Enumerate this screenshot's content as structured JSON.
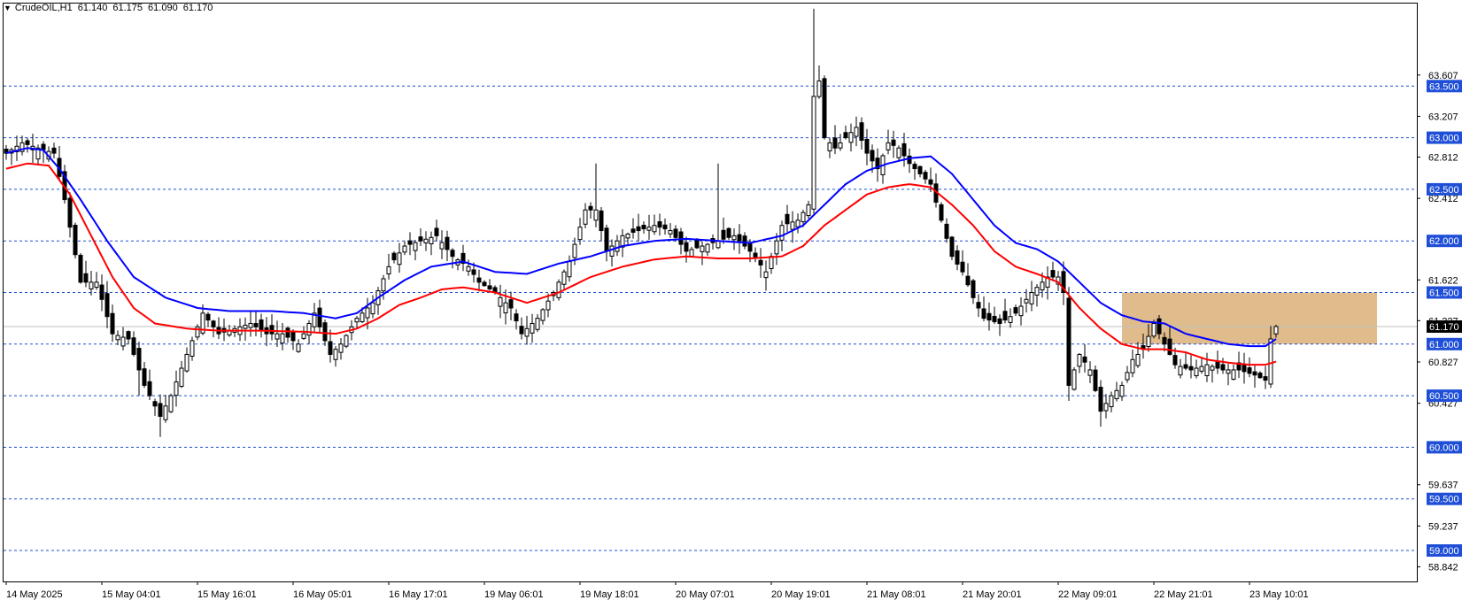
{
  "header": {
    "symbol": "CrudeOIL,H1",
    "open": "61.140",
    "high": "61.175",
    "low": "61.090",
    "close": "61.170",
    "menu_icon": "triangle-down-icon"
  },
  "chart_data": {
    "type": "candlestick",
    "title": "",
    "ylim": [
      58.7,
      64.3
    ],
    "grid": false,
    "colors": {
      "background": "#ffffff",
      "bull_body": "#ffffff",
      "bear_body": "#000000",
      "wick": "#000000",
      "ma_fast": "#0000ff",
      "ma_slow": "#ff0000",
      "level_lines": "#1f4fd6",
      "zone_fill": "#deb887",
      "current_price_line": "#c0c0c0"
    },
    "y_ticks": [
      "63.607",
      "63.207",
      "62.812",
      "62.412",
      "61.622",
      "61.227",
      "60.827",
      "60.427",
      "59.637",
      "59.237",
      "58.842"
    ],
    "y_tick_values": [
      63.607,
      63.207,
      62.812,
      62.412,
      61.622,
      61.227,
      60.827,
      60.427,
      59.637,
      59.237,
      58.842
    ],
    "levels": [
      "63.500",
      "63.000",
      "62.500",
      "62.000",
      "61.500",
      "61.000",
      "60.500",
      "60.000",
      "59.500",
      "59.000"
    ],
    "level_values": [
      63.5,
      63.0,
      62.5,
      62.0,
      61.5,
      61.0,
      60.5,
      60.0,
      59.5,
      59.0
    ],
    "current_price": "61.170",
    "current_price_value": 61.17,
    "zone": {
      "start_bar": 210,
      "end_bar": 258,
      "low": 61.0,
      "high": 61.5
    },
    "x_labels": [
      "14 May 2025",
      "15 May 04:01",
      "15 May 16:01",
      "16 May 05:01",
      "16 May 17:01",
      "19 May 06:01",
      "19 May 18:01",
      "20 May 07:01",
      "20 May 19:01",
      "21 May 08:01",
      "21 May 20:01",
      "22 May 09:01",
      "22 May 21:01",
      "23 May 10:01"
    ],
    "x_label_bars": [
      0,
      18,
      36,
      54,
      72,
      90,
      108,
      126,
      144,
      162,
      180,
      198,
      216,
      234
    ],
    "total_bars": 300,
    "close_anchors": [
      [
        0,
        62.85
      ],
      [
        3,
        62.95
      ],
      [
        6,
        62.9
      ],
      [
        9,
        62.85
      ],
      [
        11,
        62.4
      ],
      [
        14,
        61.6
      ],
      [
        17,
        61.6
      ],
      [
        20,
        61.1
      ],
      [
        23,
        61.05
      ],
      [
        26,
        60.6
      ],
      [
        29,
        60.3
      ],
      [
        31,
        60.5
      ],
      [
        34,
        60.9
      ],
      [
        37,
        61.3
      ],
      [
        40,
        61.1
      ],
      [
        43,
        61.15
      ],
      [
        46,
        61.2
      ],
      [
        49,
        61.1
      ],
      [
        52,
        61.1
      ],
      [
        55,
        61.0
      ],
      [
        58,
        61.3
      ],
      [
        61,
        60.9
      ],
      [
        63,
        61.0
      ],
      [
        66,
        61.25
      ],
      [
        69,
        61.4
      ],
      [
        72,
        61.75
      ],
      [
        75,
        61.95
      ],
      [
        78,
        62.0
      ],
      [
        81,
        62.05
      ],
      [
        84,
        61.85
      ],
      [
        87,
        61.75
      ],
      [
        89,
        61.6
      ],
      [
        92,
        61.5
      ],
      [
        95,
        61.35
      ],
      [
        97,
        61.1
      ],
      [
        100,
        61.25
      ],
      [
        103,
        61.5
      ],
      [
        106,
        61.8
      ],
      [
        109,
        62.3
      ],
      [
        111,
        62.3
      ],
      [
        113,
        61.9
      ],
      [
        116,
        62.05
      ],
      [
        119,
        62.1
      ],
      [
        122,
        62.15
      ],
      [
        125,
        62.1
      ],
      [
        128,
        61.9
      ],
      [
        131,
        61.95
      ],
      [
        134,
        62.0
      ],
      [
        137,
        62.05
      ],
      [
        140,
        61.9
      ],
      [
        143,
        61.7
      ],
      [
        146,
        62.15
      ],
      [
        149,
        62.2
      ],
      [
        151,
        62.35
      ],
      [
        152,
        63.4
      ],
      [
        153,
        63.55
      ],
      [
        154,
        63.0
      ],
      [
        156,
        62.9
      ],
      [
        158,
        63.0
      ],
      [
        160,
        63.1
      ],
      [
        162,
        62.85
      ],
      [
        164,
        62.7
      ],
      [
        166,
        62.95
      ],
      [
        168,
        62.9
      ],
      [
        170,
        62.75
      ],
      [
        172,
        62.65
      ],
      [
        174,
        62.55
      ],
      [
        176,
        62.2
      ],
      [
        178,
        61.85
      ],
      [
        180,
        61.7
      ],
      [
        182,
        61.45
      ],
      [
        184,
        61.25
      ],
      [
        187,
        61.2
      ],
      [
        190,
        61.3
      ],
      [
        193,
        61.5
      ],
      [
        196,
        61.65
      ],
      [
        198,
        61.65
      ],
      [
        199,
        61.5
      ],
      [
        200,
        60.6
      ],
      [
        202,
        60.9
      ],
      [
        204,
        60.75
      ],
      [
        206,
        60.35
      ],
      [
        208,
        60.5
      ],
      [
        210,
        60.6
      ],
      [
        212,
        60.85
      ],
      [
        214,
        60.95
      ],
      [
        216,
        61.2
      ],
      [
        218,
        61.0
      ],
      [
        220,
        60.8
      ],
      [
        223,
        60.75
      ],
      [
        226,
        60.8
      ],
      [
        229,
        60.75
      ],
      [
        232,
        60.75
      ],
      [
        235,
        60.7
      ],
      [
        237,
        60.65
      ],
      [
        238,
        61.05
      ],
      [
        239,
        61.17
      ]
    ],
    "ma_fast_anchors": [
      [
        0,
        62.85
      ],
      [
        4,
        62.9
      ],
      [
        7,
        62.88
      ],
      [
        10,
        62.7
      ],
      [
        14,
        62.4
      ],
      [
        19,
        62.0
      ],
      [
        24,
        61.65
      ],
      [
        30,
        61.45
      ],
      [
        36,
        61.35
      ],
      [
        42,
        61.32
      ],
      [
        50,
        61.32
      ],
      [
        56,
        61.3
      ],
      [
        62,
        61.25
      ],
      [
        66,
        61.3
      ],
      [
        70,
        61.45
      ],
      [
        75,
        61.62
      ],
      [
        80,
        61.75
      ],
      [
        86,
        61.8
      ],
      [
        92,
        61.7
      ],
      [
        98,
        61.68
      ],
      [
        104,
        61.78
      ],
      [
        110,
        61.85
      ],
      [
        116,
        61.95
      ],
      [
        122,
        62.0
      ],
      [
        128,
        62.02
      ],
      [
        134,
        62.0
      ],
      [
        140,
        61.98
      ],
      [
        146,
        62.05
      ],
      [
        150,
        62.15
      ],
      [
        154,
        62.35
      ],
      [
        158,
        62.55
      ],
      [
        162,
        62.68
      ],
      [
        166,
        62.75
      ],
      [
        170,
        62.8
      ],
      [
        174,
        62.82
      ],
      [
        178,
        62.65
      ],
      [
        182,
        62.4
      ],
      [
        186,
        62.15
      ],
      [
        190,
        61.98
      ],
      [
        194,
        61.92
      ],
      [
        198,
        61.8
      ],
      [
        202,
        61.6
      ],
      [
        206,
        61.4
      ],
      [
        210,
        61.28
      ],
      [
        214,
        61.22
      ],
      [
        218,
        61.2
      ],
      [
        222,
        61.1
      ],
      [
        226,
        61.05
      ],
      [
        230,
        61.0
      ],
      [
        234,
        60.98
      ],
      [
        237,
        60.98
      ],
      [
        239,
        61.05
      ]
    ],
    "ma_slow_anchors": [
      [
        0,
        62.7
      ],
      [
        4,
        62.75
      ],
      [
        8,
        62.73
      ],
      [
        12,
        62.45
      ],
      [
        16,
        62.05
      ],
      [
        20,
        61.65
      ],
      [
        24,
        61.35
      ],
      [
        28,
        61.2
      ],
      [
        34,
        61.15
      ],
      [
        40,
        61.13
      ],
      [
        48,
        61.13
      ],
      [
        56,
        61.12
      ],
      [
        62,
        61.1
      ],
      [
        66,
        61.15
      ],
      [
        70,
        61.25
      ],
      [
        74,
        61.38
      ],
      [
        78,
        61.45
      ],
      [
        82,
        61.53
      ],
      [
        86,
        61.55
      ],
      [
        92,
        61.5
      ],
      [
        98,
        61.4
      ],
      [
        104,
        61.5
      ],
      [
        110,
        61.65
      ],
      [
        116,
        61.75
      ],
      [
        122,
        61.82
      ],
      [
        128,
        61.85
      ],
      [
        134,
        61.83
      ],
      [
        140,
        61.83
      ],
      [
        146,
        61.85
      ],
      [
        150,
        61.95
      ],
      [
        154,
        62.15
      ],
      [
        158,
        62.3
      ],
      [
        162,
        62.45
      ],
      [
        166,
        62.52
      ],
      [
        170,
        62.55
      ],
      [
        174,
        62.52
      ],
      [
        178,
        62.35
      ],
      [
        182,
        62.15
      ],
      [
        186,
        61.9
      ],
      [
        190,
        61.75
      ],
      [
        194,
        61.68
      ],
      [
        198,
        61.6
      ],
      [
        202,
        61.35
      ],
      [
        206,
        61.15
      ],
      [
        210,
        61.0
      ],
      [
        214,
        60.95
      ],
      [
        218,
        60.95
      ],
      [
        222,
        60.92
      ],
      [
        226,
        60.85
      ],
      [
        230,
        60.82
      ],
      [
        234,
        60.8
      ],
      [
        237,
        60.8
      ],
      [
        239,
        60.83
      ]
    ]
  }
}
